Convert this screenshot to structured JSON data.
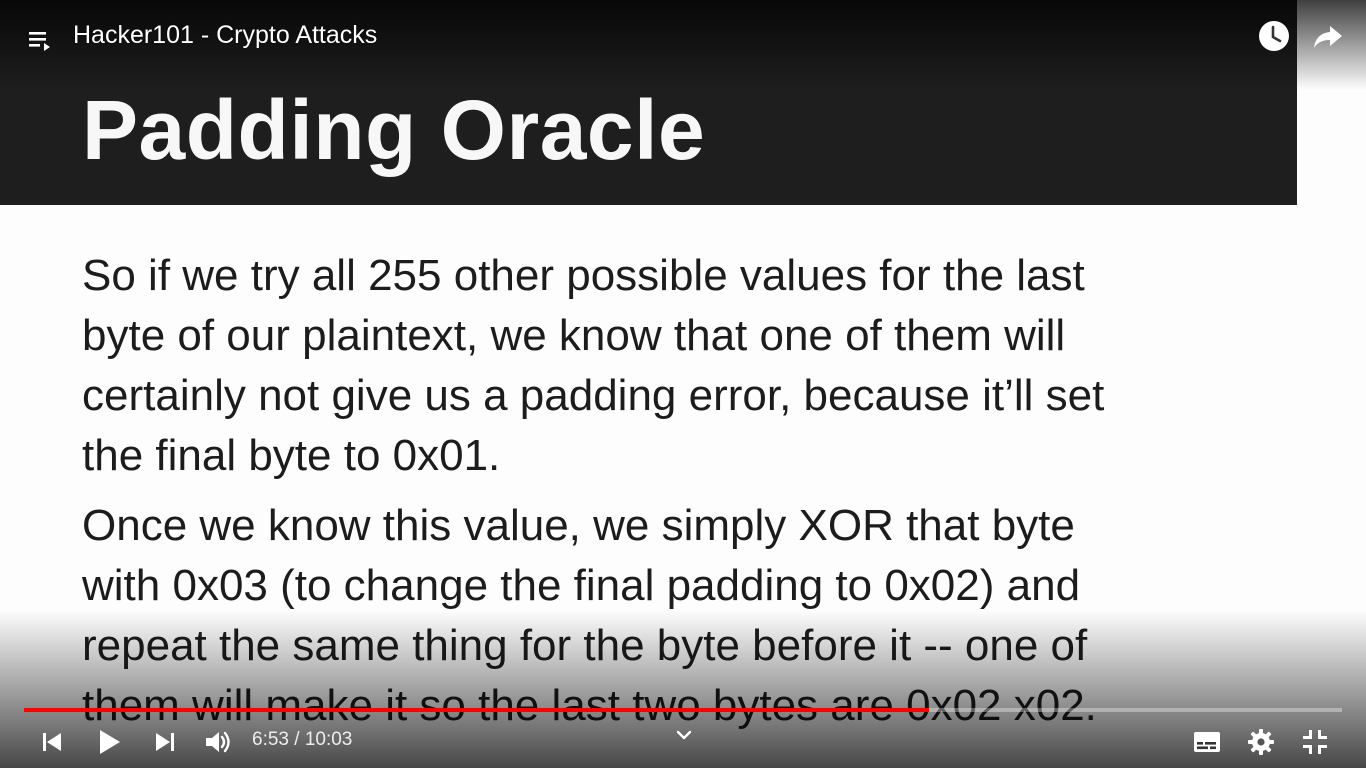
{
  "window": {
    "video_title": "Hacker101 - Crypto Attacks"
  },
  "slide": {
    "title": "Padding Oracle",
    "paragraphs": [
      {
        "lines": [
          "So if we try all 255 other possible values for the last",
          "byte of our plaintext, we know that one of them will",
          "certainly not give us a padding error, because it’ll set",
          "the final byte to 0x01."
        ]
      },
      {
        "lines": [
          "Once we know this value, we simply XOR that byte",
          "with 0x03 (to change the final padding to 0x02) and",
          "repeat the same thing for the byte before it -- one of",
          "them will make it so the last two bytes are 0x02 x02."
        ]
      }
    ]
  },
  "player": {
    "time_display": "6:53 / 10:03",
    "progress_fraction": 0.687,
    "icons": {
      "playlist": "playlist-icon",
      "watch_later": "clock-icon",
      "share": "share-icon",
      "previous": "previous-icon",
      "play": "play-icon",
      "next": "next-icon",
      "volume": "volume-icon",
      "chevron": "chevron-down-icon",
      "captions": "subtitles-icon",
      "settings": "gear-icon",
      "exit_fullscreen": "exit-fullscreen-icon"
    },
    "colors": {
      "progress_played": "#ff0000",
      "header_bg": "#1e1e1e"
    }
  }
}
